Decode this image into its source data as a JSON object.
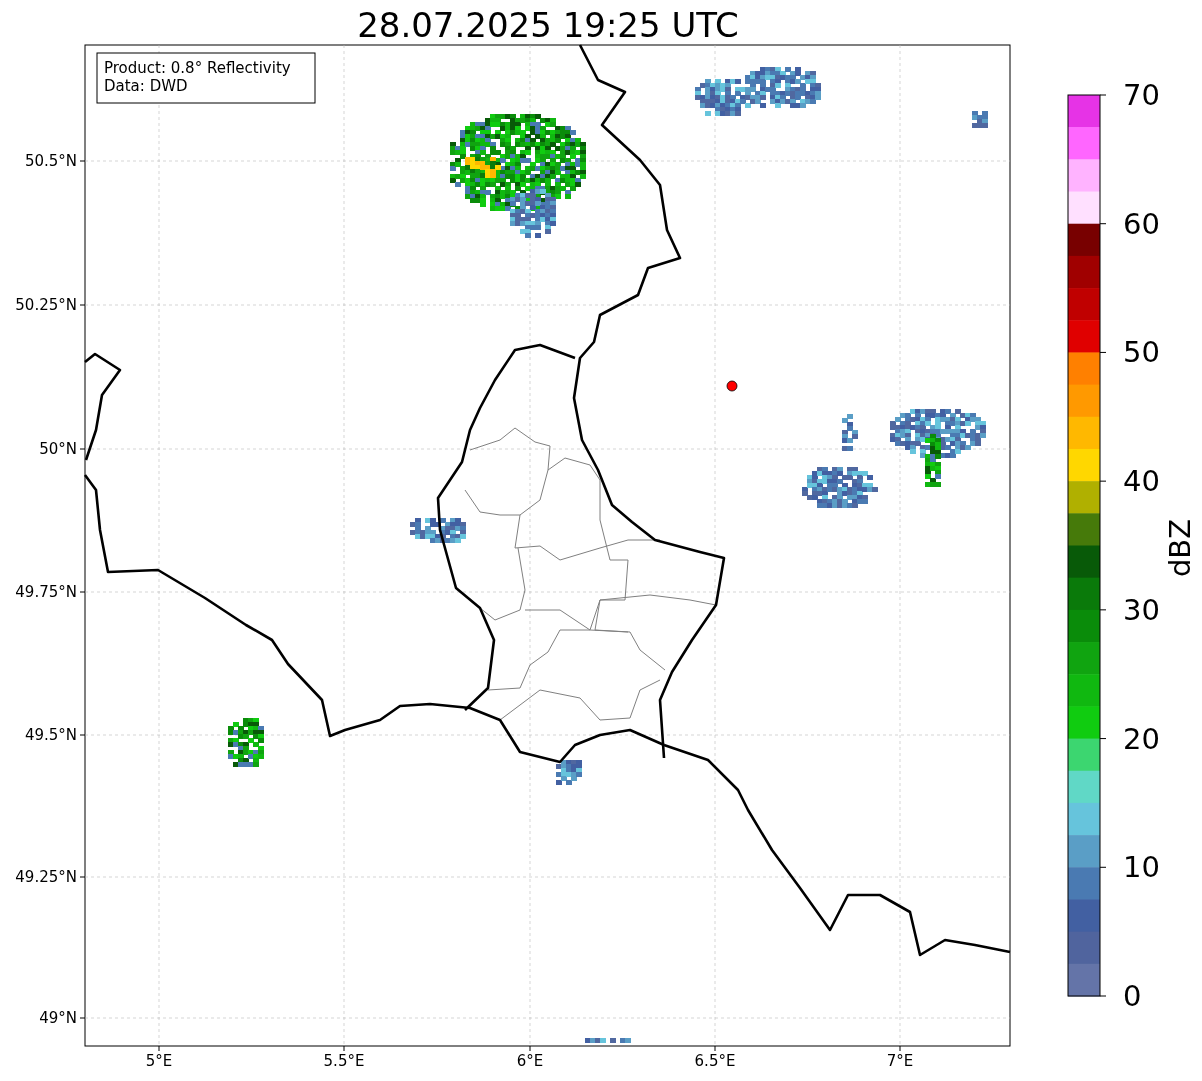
{
  "title": "28.07.2025 19:25 UTC",
  "legend": [
    "Product: 0.8° Reflectivity",
    "Data: DWD"
  ],
  "x_ticks": [
    "5°E",
    "5.5°E",
    "6°E",
    "6.5°E",
    "7°E"
  ],
  "y_ticks": [
    "50.5°N",
    "50.25°N",
    "50°N",
    "49.75°N",
    "49.5°N",
    "49.25°N",
    "49°N"
  ],
  "colorbar": {
    "label": "dBZ",
    "ticks": [
      "70",
      "60",
      "50",
      "40",
      "30",
      "20",
      "10",
      "0"
    ],
    "segments": [
      {
        "color": "#e633e6"
      },
      {
        "color": "#ff66ff"
      },
      {
        "color": "#ffb3ff"
      },
      {
        "color": "#ffe0ff"
      },
      {
        "color": "#780000"
      },
      {
        "color": "#a00000"
      },
      {
        "color": "#c00000"
      },
      {
        "color": "#e00000"
      },
      {
        "color": "#ff8000"
      },
      {
        "color": "#ff9900"
      },
      {
        "color": "#ffb800"
      },
      {
        "color": "#ffd700"
      },
      {
        "color": "#b0b000"
      },
      {
        "color": "#467a0a"
      },
      {
        "color": "#085a08"
      },
      {
        "color": "#0a7a0a"
      },
      {
        "color": "#0a8c0a"
      },
      {
        "color": "#10a410"
      },
      {
        "color": "#10b810"
      },
      {
        "color": "#10cc10"
      },
      {
        "color": "#3cd670"
      },
      {
        "color": "#60d8c6"
      },
      {
        "color": "#66c4dc"
      },
      {
        "color": "#5a9ec6"
      },
      {
        "color": "#4a7ab2"
      },
      {
        "color": "#4260a2"
      },
      {
        "color": "#50649e"
      },
      {
        "color": "#6474a8"
      }
    ]
  }
}
